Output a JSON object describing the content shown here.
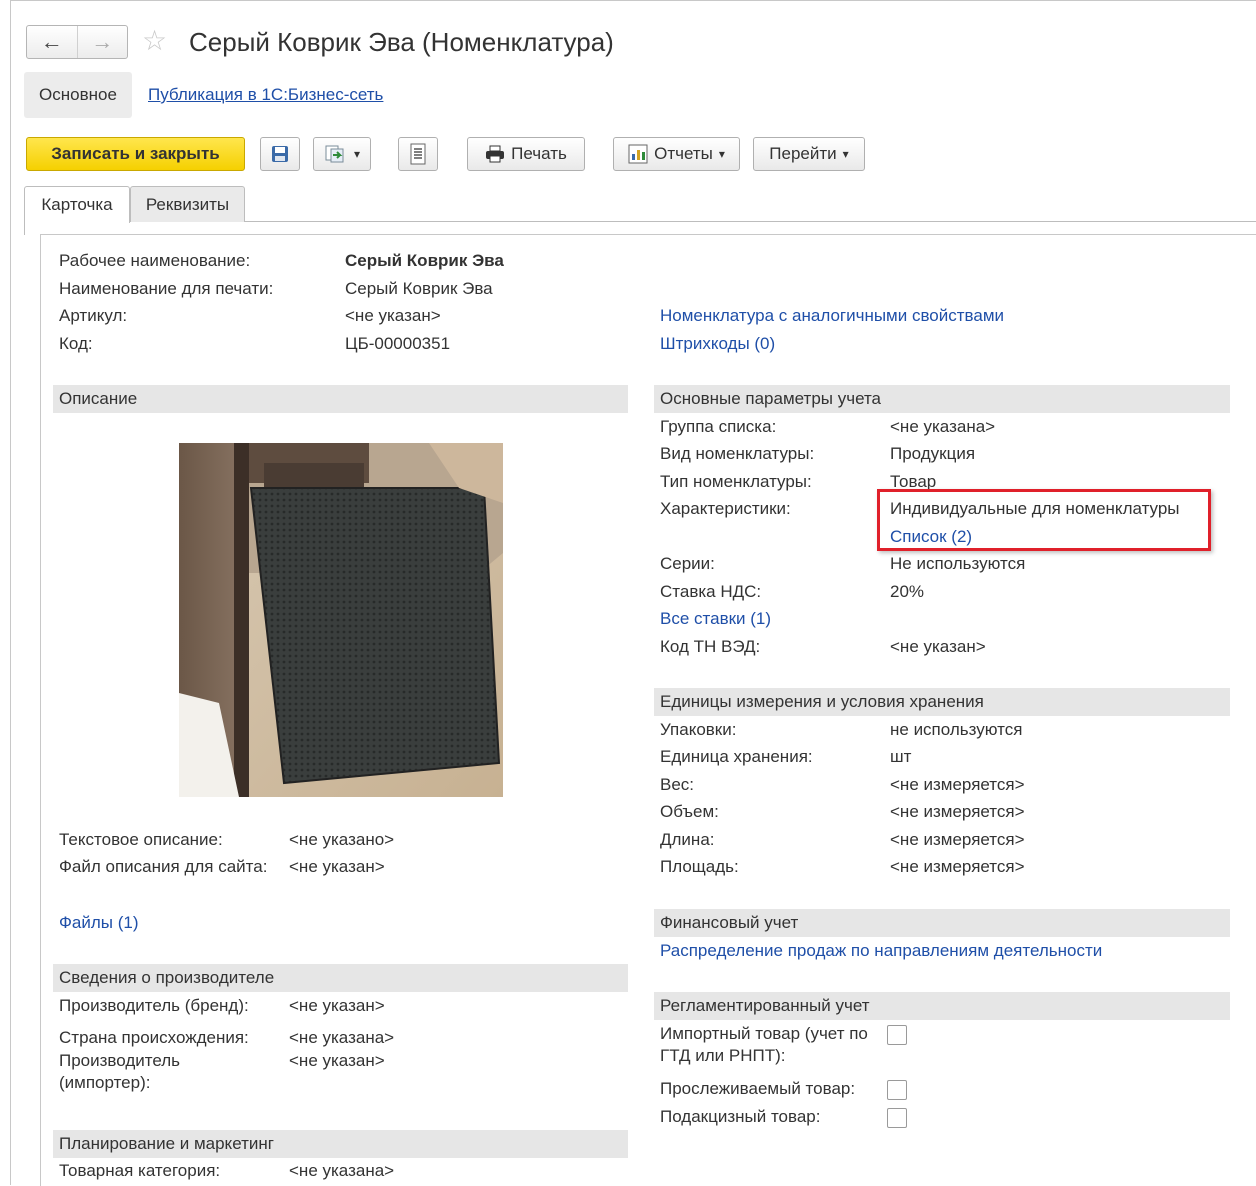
{
  "window": {
    "title": "Серый Коврик Эва (Номенклатура)"
  },
  "nav": {
    "back": "←",
    "forward": "→",
    "favorite_icon": "star-outline-icon"
  },
  "top_tabs": {
    "main": "Основное",
    "publication": "Публикация в 1С:Бизнес-сеть"
  },
  "toolbar": {
    "save_close": "Записать и закрыть",
    "print": "Печать",
    "reports": "Отчеты",
    "goto": "Перейти",
    "dropdown_glyph": "▾"
  },
  "form_tabs": {
    "card": "Карточка",
    "requisites": "Реквизиты"
  },
  "header_fields": {
    "work_name_label": "Рабочее наименование:",
    "work_name_value": "Серый Коврик Эва",
    "print_name_label": "Наименование для печати:",
    "print_name_value": "Серый Коврик Эва",
    "article_label": "Артикул:",
    "article_value": "<не указан>",
    "code_label": "Код:",
    "code_value": "ЦБ-00000351"
  },
  "right_links": {
    "similar": "Номенклатура с аналогичными свойствами",
    "barcodes": "Штрихкоды (0)"
  },
  "description": {
    "title": "Описание",
    "text_label": "Текстовое описание:",
    "text_value": "<не указано>",
    "site_file_label": "Файл описания для сайта:",
    "site_file_value": "<не указан>",
    "files_link": "Файлы (1)"
  },
  "manufacturer": {
    "title": "Сведения о производителе",
    "brand_label": "Производитель (бренд):",
    "brand_value": "<не указан>",
    "country_label": "Страна происхождения:",
    "country_value": "<не указана>",
    "importer_label_1": "Производитель",
    "importer_label_2": "(импортер):",
    "importer_value": "<не указан>"
  },
  "planning": {
    "title": "Планирование и маркетинг",
    "category_label": "Товарная категория:",
    "category_value": "<не указана>"
  },
  "accounting": {
    "title": "Основные параметры учета",
    "group_label": "Группа списка:",
    "group_value": "<не указана>",
    "kind_label": "Вид номенклатуры:",
    "kind_value": "Продукция",
    "type_label": "Тип номенклатуры:",
    "type_value": "Товар",
    "chars_label": "Характеристики:",
    "chars_value": "Индивидуальные для номенклатуры",
    "chars_link": "Список (2)",
    "series_label": "Серии:",
    "series_value": "Не используются",
    "vat_label": "Ставка НДС:",
    "vat_value": "20%",
    "all_rates_link": "Все ставки (1)",
    "tnved_label": "Код ТН ВЭД:",
    "tnved_value": "<не указан>"
  },
  "units": {
    "title": "Единицы измерения и условия хранения",
    "packs_label": "Упаковки:",
    "packs_value": "не используются",
    "storage_label": "Единица хранения:",
    "storage_value": "шт",
    "weight_label": "Вес:",
    "weight_value": "<не измеряется>",
    "volume_label": "Объем:",
    "volume_value": "<не измеряется>",
    "length_label": "Длина:",
    "length_value": "<не измеряется>",
    "area_label": "Площадь:",
    "area_value": "<не измеряется>"
  },
  "finance": {
    "title": "Финансовый учет",
    "link": "Распределение продаж по направлениям деятельности"
  },
  "regulated": {
    "title": "Регламентированный учет",
    "import_label_1": "Импортный товар (учет по",
    "import_label_2": "ГТД или РНПТ):",
    "import_checked": false,
    "traceable_label": "Прослеживаемый товар:",
    "traceable_checked": false,
    "excise_label": "Подакцизный товар:",
    "excise_checked": false
  },
  "colors": {
    "accent_yellow": "#f5d000",
    "link": "#1f4fa8",
    "highlight": "#e0202a",
    "section_bg": "#e6e6e6"
  }
}
